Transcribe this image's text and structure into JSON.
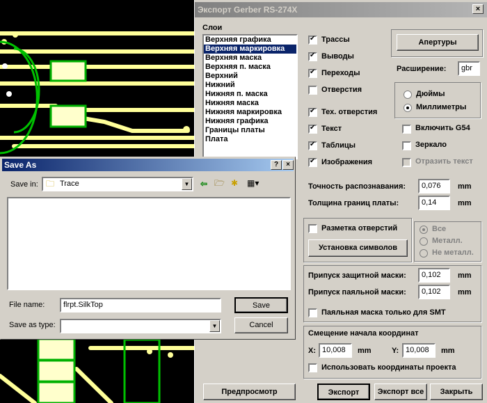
{
  "gerber": {
    "title": "Экспорт Gerber RS-274X",
    "close": "×",
    "layers_label": "Слои",
    "layers": [
      "Верхняя графика",
      "Верхняя маркировка",
      "Верхняя маска",
      "Верхняя п. маска",
      "Верхний",
      "Нижний",
      "Нижняя п. маска",
      "Нижняя маска",
      "Нижняя маркировка",
      "Нижняя графика",
      "Границы платы",
      "Плата"
    ],
    "selected_layer": "Верхняя маркировка",
    "checks": {
      "tracks": {
        "label": "Трассы",
        "checked": true
      },
      "pads": {
        "label": "Выводы",
        "checked": true
      },
      "vias": {
        "label": "Переходы",
        "checked": true
      },
      "holes": {
        "label": "Отверстия",
        "checked": false
      },
      "tech_holes": {
        "label": "Тех. отверстия",
        "checked": true
      },
      "text": {
        "label": "Текст",
        "checked": true
      },
      "tables": {
        "label": "Таблицы",
        "checked": true
      },
      "images": {
        "label": "Изображения",
        "checked": true
      }
    },
    "apertures_button": "Апертуры",
    "extension_label": "Расширение:",
    "extension_value": "gbr",
    "units": {
      "inches": "Дюймы",
      "mm": "Миллиметры",
      "selected": "mm"
    },
    "include_g54": "Включить G54",
    "mirror": "Зеркало",
    "mirror_text": "Отразить текст",
    "recognition_label": "Точность распознавания:",
    "recognition_value": "0,076",
    "board_border_label": "Толщина границ платы:",
    "board_border_value": "0,14",
    "unit_mm": "mm",
    "hole_marking": "Разметка отверстий",
    "symbols_button": "Установка символов",
    "hole_options": {
      "all": "Все",
      "metal": "Металл.",
      "nonmetal": "Не металл."
    },
    "mask_clearance_label": "Припуск защитной маски:",
    "mask_clearance_value": "0,102",
    "paste_clearance_label": "Припуск паяльной маски:",
    "paste_clearance_value": "0,102",
    "paste_smt_only": "Паяльная маска только для SMT",
    "origin_label": "Смещение начала координат",
    "x_label": "X:",
    "x_value": "10,008",
    "y_label": "Y:",
    "y_value": "10,008",
    "use_project_coords": "Использовать координаты проекта",
    "preview_button": "Предпросмотр",
    "export_button": "Экспорт",
    "export_all_button": "Экспорт все",
    "close_button": "Закрыть"
  },
  "saveas": {
    "title": "Save As",
    "help": "?",
    "close": "×",
    "save_in_label": "Save in:",
    "save_in_value": "Trace",
    "file_name_label": "File name:",
    "file_name_value": "flrpt.SilkTop",
    "save_as_type_label": "Save as type:",
    "save_as_type_value": "",
    "save_button": "Save",
    "cancel_button": "Cancel"
  }
}
